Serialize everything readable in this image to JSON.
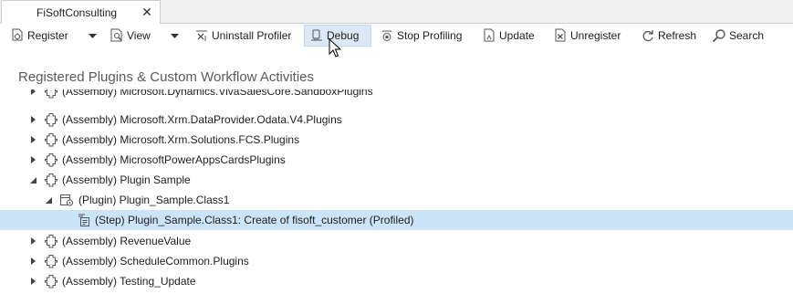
{
  "tab": {
    "title": "FiSoftConsulting",
    "close_glyph": "✕"
  },
  "toolbar": {
    "register": {
      "label": "Register",
      "icon": "register-icon"
    },
    "view": {
      "label": "View",
      "icon": "view-icon"
    },
    "uninstall_profiler": {
      "label": "Uninstall Profiler",
      "icon": "uninstall-profiler-icon"
    },
    "debug": {
      "label": "Debug",
      "icon": "debug-icon"
    },
    "stop_profiling": {
      "label": "Stop Profiling",
      "icon": "stop-profiling-icon"
    },
    "update": {
      "label": "Update",
      "icon": "update-icon"
    },
    "unregister": {
      "label": "Unregister",
      "icon": "unregister-icon"
    },
    "refresh": {
      "label": "Refresh",
      "icon": "refresh-icon"
    },
    "search": {
      "label": "Search",
      "icon": "search-icon"
    }
  },
  "section_title": "Registered Plugins & Custom Workflow Activities",
  "tree": {
    "rows": [
      {
        "label": "(Assembly) Microsoft.Dynamics.VivaSalesCore.SandboxPlugins",
        "type": "assembly",
        "expanded": false
      },
      {
        "label": "(Assembly) Microsoft.Xrm.DataProvider.Odata.V4.Plugins",
        "type": "assembly",
        "expanded": false
      },
      {
        "label": "(Assembly) Microsoft.Xrm.Solutions.FCS.Plugins",
        "type": "assembly",
        "expanded": false
      },
      {
        "label": "(Assembly) MicrosoftPowerAppsCardsPlugins",
        "type": "assembly",
        "expanded": false
      },
      {
        "label": "(Assembly) Plugin Sample",
        "type": "assembly",
        "expanded": true
      },
      {
        "label": "(Plugin) Plugin_Sample.Class1",
        "type": "plugin",
        "expanded": true
      },
      {
        "label": "(Step) Plugin_Sample.Class1: Create of fisoft_customer (Profiled)",
        "type": "step",
        "selected": true
      },
      {
        "label": "(Assembly) RevenueValue",
        "type": "assembly",
        "expanded": false
      },
      {
        "label": "(Assembly) ScheduleCommon.Plugins",
        "type": "assembly",
        "expanded": false
      },
      {
        "label": "(Assembly) Testing_Update",
        "type": "assembly",
        "expanded": false
      }
    ]
  },
  "colors": {
    "selection": "#cce4f7",
    "active_button": "#dbe8f5",
    "title_text": "#5a5a5a"
  }
}
